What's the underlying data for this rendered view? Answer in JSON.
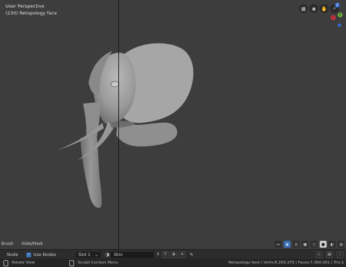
{
  "viewport": {
    "view_name": "User Perspective",
    "object_info": "(230) Retopology face",
    "nav_buttons": [
      "grid-icon",
      "camera-icon",
      "hand-icon",
      "zoom-icon"
    ],
    "gizmo_axes": [
      {
        "name": "z-axis",
        "label": "Z",
        "color": "#2e6bd8"
      },
      {
        "name": "y-axis",
        "label": "Y",
        "color": "#6fb83a"
      },
      {
        "name": "x-axis",
        "label": "X",
        "color": "#e0343c"
      }
    ]
  },
  "bottom_labels": {
    "brush": "Brush",
    "hide_mask": "Hide/Mask"
  },
  "header": {
    "node": "Node",
    "use_nodes": "Use Nodes",
    "slot": "Slot 1",
    "material": "Skin",
    "user_count": "3"
  },
  "status": {
    "left": "Rotate View",
    "middle": "Sculpt Context Menu",
    "right": "Retopology face | Verts:8,309,370 | Faces:7,360,001 | Tris:1"
  }
}
